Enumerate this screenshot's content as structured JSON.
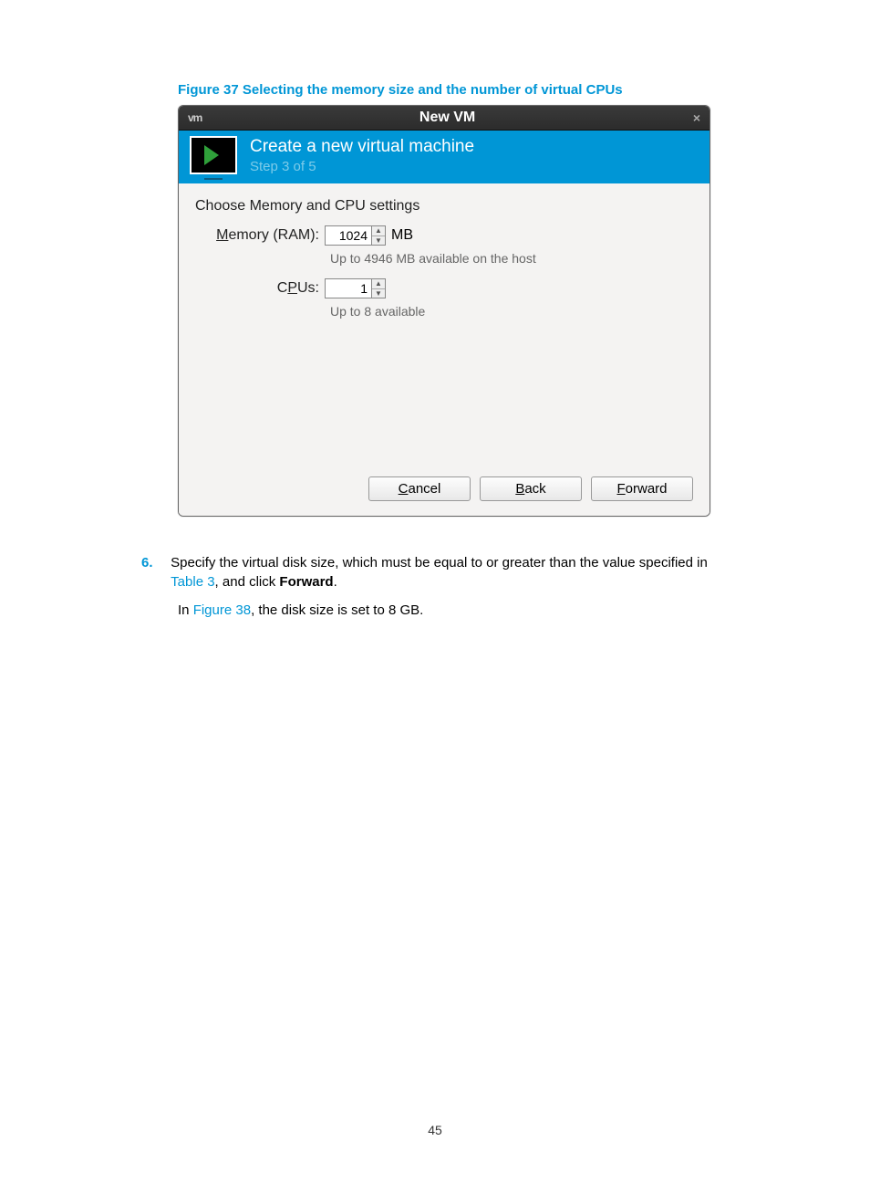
{
  "figure_caption": "Figure 37 Selecting the memory size and the number of virtual CPUs",
  "dialog": {
    "title": "New VM",
    "header_title": "Create a new virtual machine",
    "step": "Step 3 of 5",
    "section": "Choose Memory and CPU settings",
    "memory_label_pre": "M",
    "memory_label_rest": "emory (RAM):",
    "memory_value": "1024",
    "memory_unit": "MB",
    "memory_hint": "Up to 4946 MB available on the host",
    "cpu_label_pre": "C",
    "cpu_label_u": "P",
    "cpu_label_rest": "Us:",
    "cpu_value": "1",
    "cpu_hint": "Up to 8 available",
    "cancel_pre": "C",
    "cancel_rest": "ancel",
    "back_pre": "B",
    "back_rest": "ack",
    "forward_pre": "F",
    "forward_rest": "orward"
  },
  "list": {
    "num": "6.",
    "text_a": "Specify the virtual disk size, which must be equal to or greater than the value specified in ",
    "table_link": "Table 3",
    "text_b": ", and click ",
    "bold": "Forward",
    "text_c": ".",
    "sub_a": "In ",
    "fig_link": "Figure 38",
    "sub_b": ", the disk size is set to 8 GB."
  },
  "page_number": "45"
}
